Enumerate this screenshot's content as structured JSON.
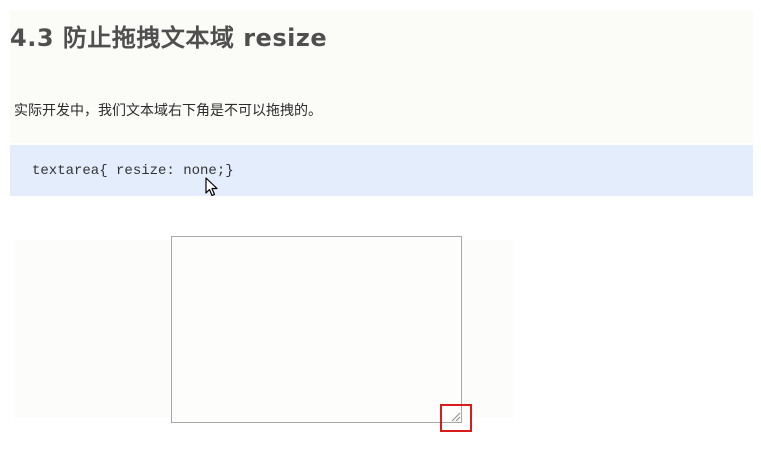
{
  "section": {
    "title": "4.3 防止拖拽文本域 resize",
    "description": "实际开发中，我们文本域右下角是不可以拖拽的。"
  },
  "code": {
    "text": "textarea{ resize: none;}"
  },
  "demo": {
    "textarea_value": "",
    "highlight_color": "#d81b1b"
  },
  "icons": {
    "cursor": "arrow-cursor-icon",
    "grip": "resize-grip-icon"
  }
}
